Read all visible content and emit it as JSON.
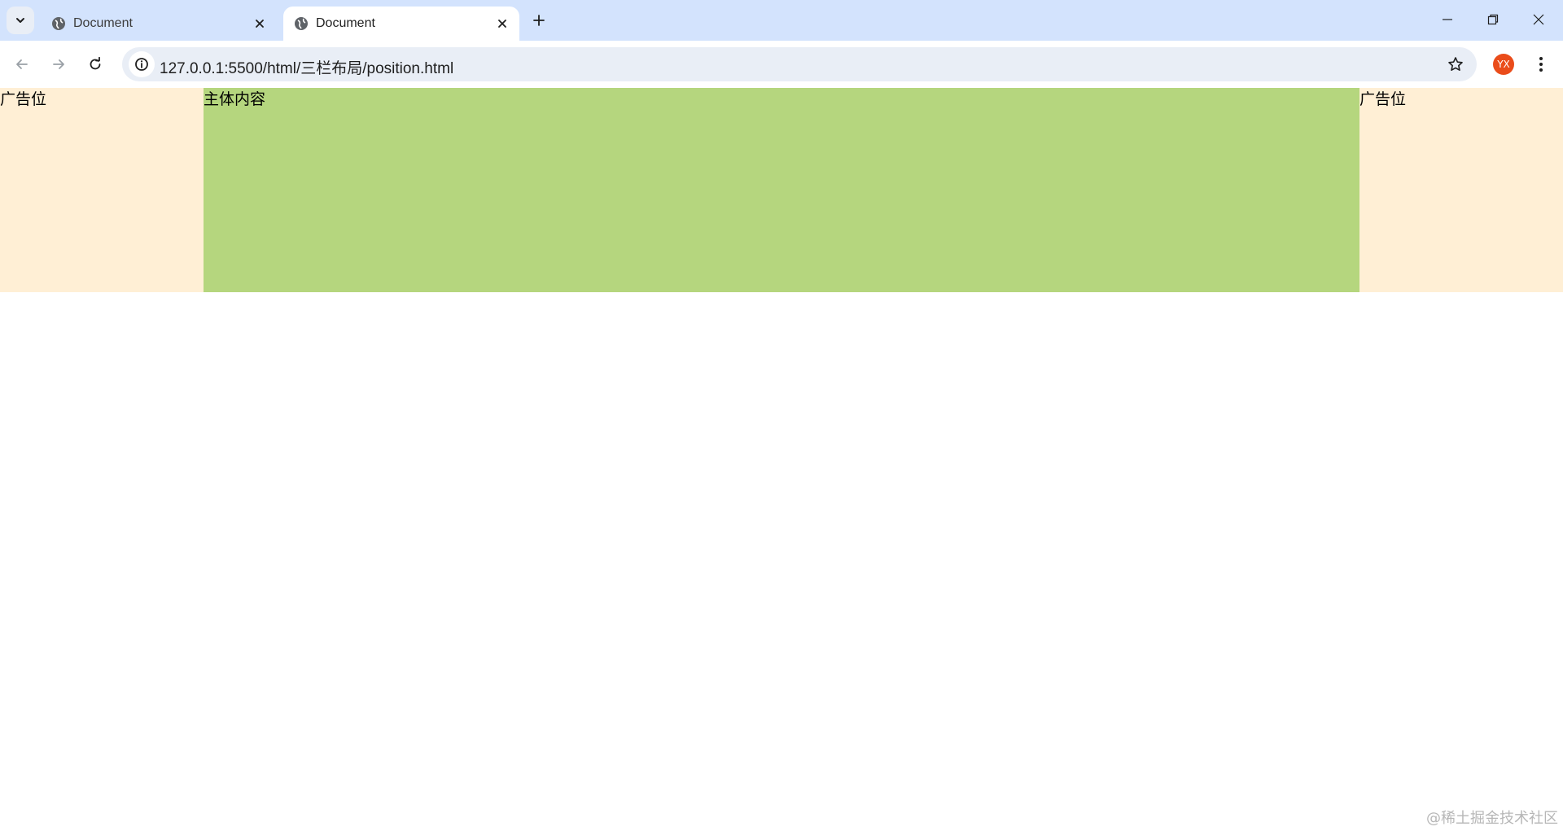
{
  "browser": {
    "tabs": [
      {
        "title": "Document",
        "active": false
      },
      {
        "title": "Document",
        "active": true
      }
    ],
    "address": {
      "url": "127.0.0.1:5500/html/三栏布局/position.html"
    },
    "profile_initials": "YX"
  },
  "page": {
    "left_ad": "广告位",
    "main": "主体内容",
    "right_ad": "广告位",
    "watermark": "@稀土掘金技术社区"
  },
  "colors": {
    "tabstrip": "#d3e3fd",
    "side_columns": "#ffefd5",
    "main_column": "#b5d67e",
    "avatar": "#ea4c1a"
  }
}
